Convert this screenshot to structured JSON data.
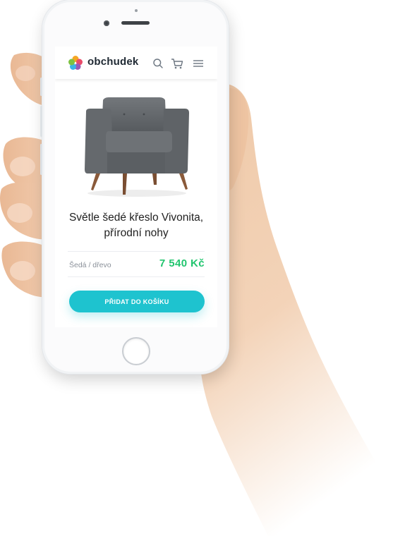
{
  "header": {
    "brand": "obchudek",
    "icons": [
      "search-icon",
      "cart-icon",
      "menu-icon"
    ]
  },
  "product": {
    "image": "gray-armchair-image",
    "title": "Světle šedé křeslo Vivonita, přírodní nohy",
    "variant": "Šedá / dřevo",
    "price": "7 540 Kč"
  },
  "actions": {
    "add_to_cart": "PŘIDAT DO KOŠÍKU"
  },
  "colors": {
    "accent": "#1ec3cf",
    "price": "#22c56f",
    "logo_petals": [
      "#f5a623",
      "#e94b6a",
      "#3bb3e6",
      "#7dc242",
      "#9b59b6"
    ]
  }
}
